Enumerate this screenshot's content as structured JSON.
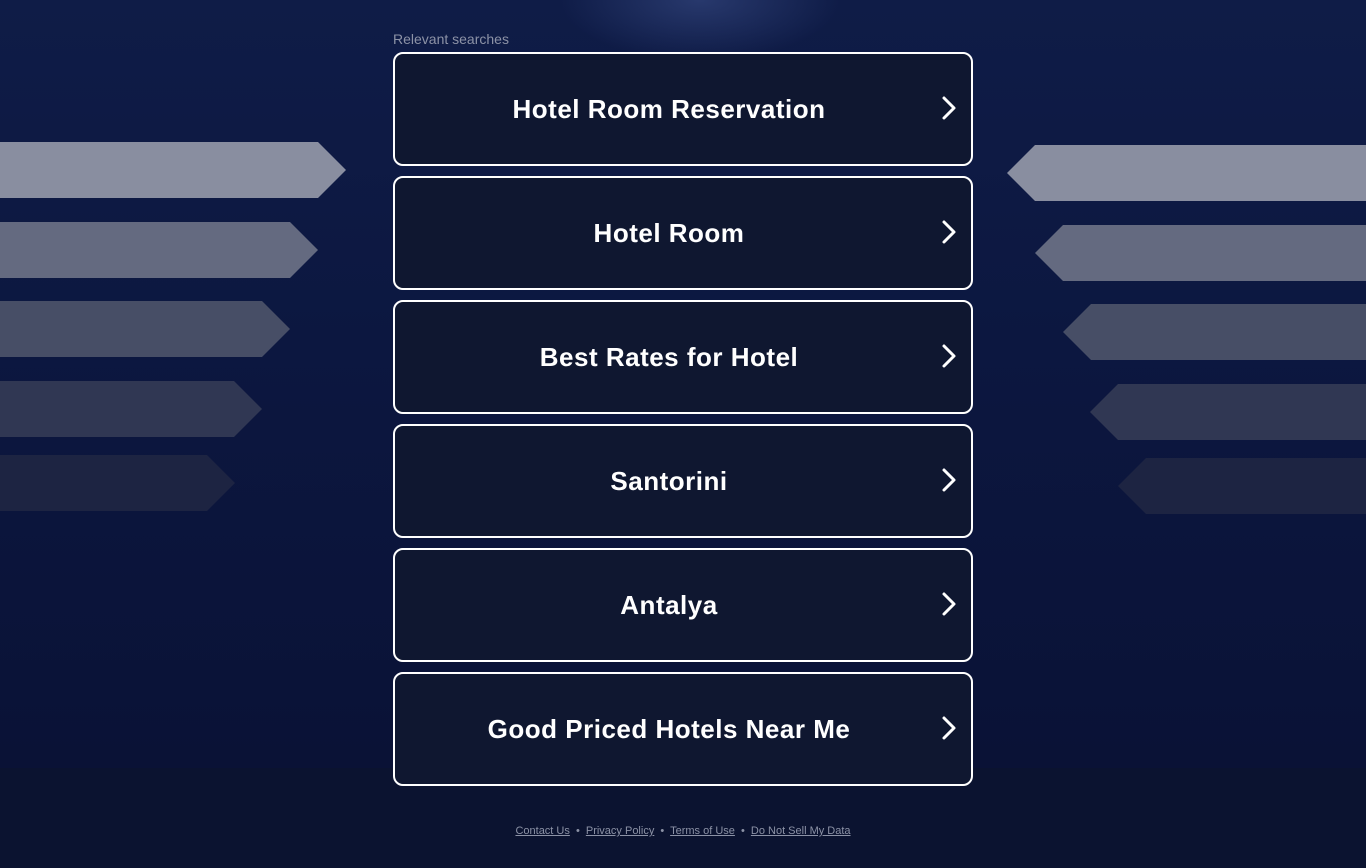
{
  "heading": "Relevant searches",
  "items": [
    {
      "label": "Hotel Room Reservation"
    },
    {
      "label": "Hotel Room"
    },
    {
      "label": "Best Rates for Hotel"
    },
    {
      "label": "Santorini"
    },
    {
      "label": "Antalya"
    },
    {
      "label": "Good Priced Hotels Near Me"
    }
  ],
  "footer": {
    "contact": "Contact Us",
    "privacy": "Privacy Policy",
    "terms": "Terms of Use",
    "dnsmd": "Do Not Sell My Data",
    "separator": "•"
  },
  "colors": {
    "background": "#0b1330",
    "card_background": "#0f1730",
    "card_border": "#ffffff",
    "text": "#ffffff",
    "muted": "#8c92a6"
  }
}
